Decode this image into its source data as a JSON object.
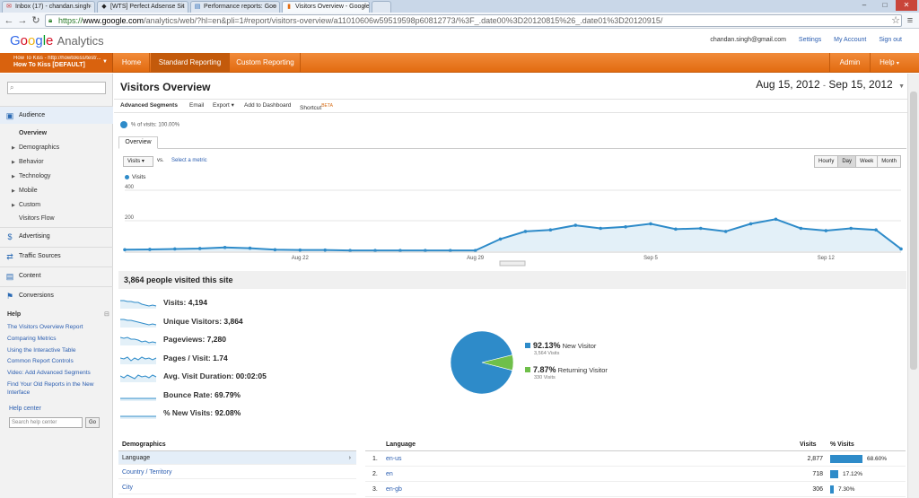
{
  "browser": {
    "tabs": [
      {
        "title": "Inbox (17) - chandan.singh",
        "icon": "mail-icon"
      },
      {
        "title": "[WTS] Perfect Adsense Sit",
        "icon": "page-icon"
      },
      {
        "title": "Performance reports: Goo",
        "icon": "chart-icon"
      },
      {
        "title": "Visitors Overview - Google",
        "icon": "ga-icon"
      }
    ],
    "url_scheme": "https://",
    "url_host": "www.google.com",
    "url_rest": "/analytics/web/?hl=en&pli=1#report/visitors-overview/a11010606w59519598p60812773/%3F_.date00%3D20120815%26_.date01%3D20120915/"
  },
  "header": {
    "logo_google": "Google",
    "logo_product": "Analytics",
    "email": "chandan.singh@gmail.com",
    "links": [
      "Settings",
      "My Account",
      "Sign out"
    ]
  },
  "nav": {
    "account_line1": "How To Kiss - http://howtokiss/test/...",
    "account_line2": "How To Kiss [DEFAULT]",
    "tabs": [
      "Home",
      "Standard Reporting",
      "Custom Reporting"
    ],
    "admin": "Admin",
    "help": "Help"
  },
  "sidebar": {
    "search_placeholder": "",
    "sections": [
      {
        "label": "Audience",
        "icon": "person-icon"
      },
      {
        "label": "Advertising",
        "icon": "dollar-icon"
      },
      {
        "label": "Traffic Sources",
        "icon": "arrows-icon"
      },
      {
        "label": "Content",
        "icon": "document-icon"
      },
      {
        "label": "Conversions",
        "icon": "flag-icon"
      }
    ],
    "audience_items": [
      "Overview",
      "Demographics",
      "Behavior",
      "Technology",
      "Mobile",
      "Custom",
      "Visitors Flow"
    ],
    "help_title": "Help",
    "help_links": [
      "The Visitors Overview Report",
      "Comparing Metrics",
      "Using the Interactive Table",
      "Common Report Controls",
      "Video: Add Advanced Segments",
      "Find Your Old Reports in the New Interface"
    ],
    "help_center": "Help center",
    "help_center_placeholder": "Search help center",
    "go": "Go"
  },
  "main": {
    "title": "Visitors Overview",
    "date_start": "Aug 15, 2012",
    "date_sep": "-",
    "date_end": "Sep 15, 2012",
    "actions": [
      "Advanced Segments",
      "Email",
      "Export",
      "Add to Dashboard",
      "Shortcut"
    ],
    "beta": "BETA",
    "segment": "% of visits: 100.00%",
    "overview_tab": "Overview",
    "metric_select": "Visits",
    "vs": "vs.",
    "select_metric": "Select a metric",
    "granularity": [
      "Hourly",
      "Day",
      "Week",
      "Month"
    ],
    "people": "3,864 people visited this site"
  },
  "chart_data": {
    "type": "area",
    "series": [
      {
        "name": "Visits",
        "values": [
          10,
          12,
          15,
          18,
          25,
          20,
          10,
          8,
          8,
          5,
          5,
          5,
          5,
          5,
          5,
          80,
          130,
          140,
          170,
          150,
          160,
          180,
          145,
          150,
          130,
          180,
          210,
          150,
          135,
          150,
          140,
          15
        ]
      }
    ],
    "y_ticks": [
      "400",
      "200"
    ],
    "ylim": [
      0,
      400
    ],
    "x_ticks": [
      "Aug 22",
      "Aug 29",
      "Sep 5",
      "Sep 12"
    ],
    "x_tick_index": [
      7,
      14,
      21,
      28
    ],
    "color": "#2e8bc9"
  },
  "metrics": [
    {
      "label": "Visits:",
      "value": "4,194"
    },
    {
      "label": "Unique Visitors:",
      "value": "3,864"
    },
    {
      "label": "Pageviews:",
      "value": "7,280"
    },
    {
      "label": "Pages / Visit:",
      "value": "1.74"
    },
    {
      "label": "Avg. Visit Duration:",
      "value": "00:02:05"
    },
    {
      "label": "Bounce Rate:",
      "value": "69.79%"
    },
    {
      "label": "% New Visits:",
      "value": "92.08%"
    }
  ],
  "pie": {
    "slices": [
      {
        "pct": "92.13%",
        "label": "New Visitor",
        "visits": "3,564 Visits",
        "value": 92.13,
        "color": "#2e8bc9"
      },
      {
        "pct": "7.87%",
        "label": "Returning Visitor",
        "visits": "330 Visits",
        "value": 7.87,
        "color": "#6fbf4a"
      }
    ]
  },
  "demographics": {
    "header": "Demographics",
    "rows": [
      "Language",
      "Country / Territory",
      "City"
    ]
  },
  "language": {
    "header": "Language",
    "col_visits": "Visits",
    "col_pct": "% Visits",
    "rows": [
      {
        "idx": "1.",
        "name": "en-us",
        "visits": "2,877",
        "pct": "68.60%",
        "frac": 0.686
      },
      {
        "idx": "2.",
        "name": "en",
        "visits": "718",
        "pct": "17.12%",
        "frac": 0.1712
      },
      {
        "idx": "3.",
        "name": "en-gb",
        "visits": "306",
        "pct": "7.30%",
        "frac": 0.073
      }
    ]
  }
}
